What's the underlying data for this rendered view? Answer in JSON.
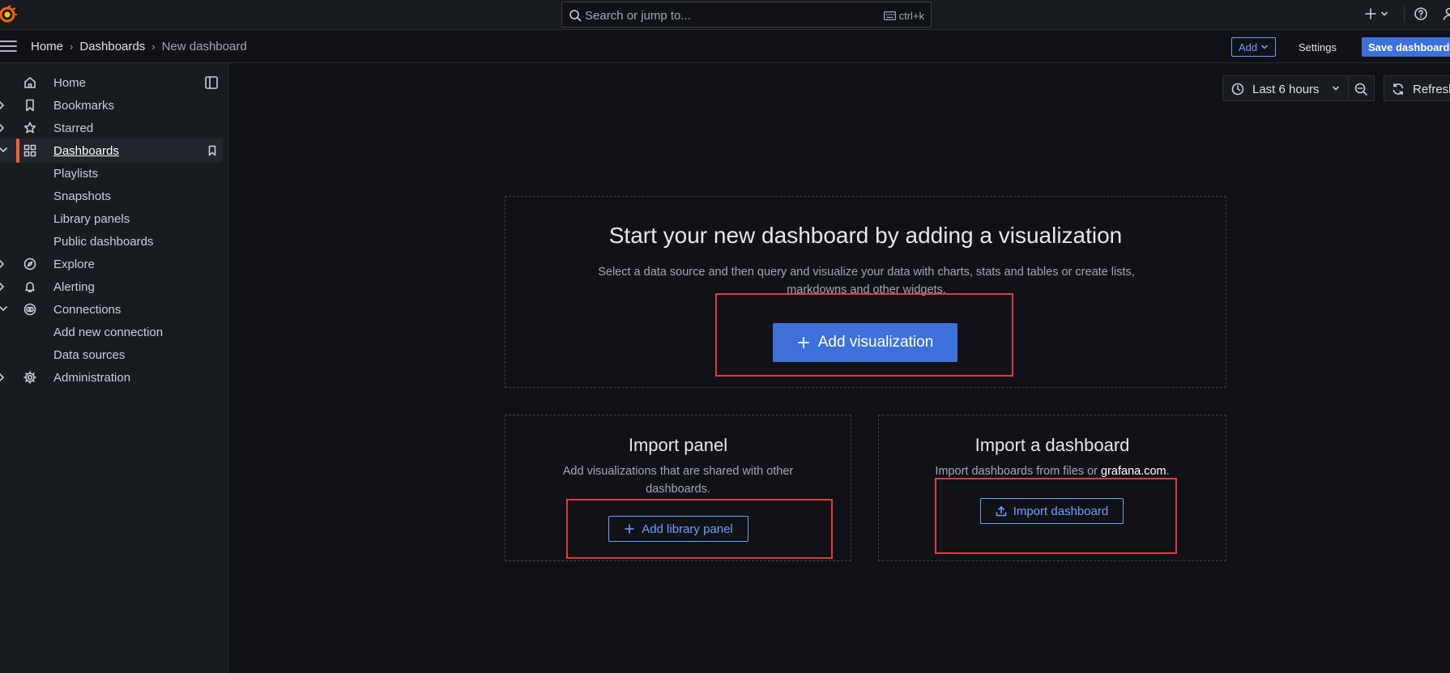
{
  "topbar": {
    "search_placeholder": "Search or jump to...",
    "search_shortcut": "ctrl+k",
    "icons": [
      "grafana-logo",
      "search-icon",
      "keyboard-icon",
      "plus-icon",
      "chevron-down-icon",
      "help-icon",
      "profile-icon"
    ]
  },
  "breadcrumb": {
    "home": "Home",
    "dashboards": "Dashboards",
    "current": "New dashboard"
  },
  "actions": {
    "add_label": "Add",
    "settings_label": "Settings",
    "save_label": "Save dashboard"
  },
  "sidebar": {
    "items": [
      {
        "label": "Home",
        "icon": "home-icon"
      },
      {
        "label": "Bookmarks",
        "icon": "bookmark-icon"
      },
      {
        "label": "Starred",
        "icon": "star-icon"
      },
      {
        "label": "Dashboards",
        "icon": "apps-icon"
      },
      {
        "label": "Playlists"
      },
      {
        "label": "Snapshots"
      },
      {
        "label": "Library panels"
      },
      {
        "label": "Public dashboards"
      },
      {
        "label": "Explore",
        "icon": "compass-icon"
      },
      {
        "label": "Alerting",
        "icon": "bell-icon"
      },
      {
        "label": "Connections",
        "icon": "link-icon"
      },
      {
        "label": "Add new connection"
      },
      {
        "label": "Data sources"
      },
      {
        "label": "Administration",
        "icon": "cog-icon"
      }
    ]
  },
  "toolbar": {
    "time_range": "Last 6 hours",
    "refresh_label": "Refresh"
  },
  "main": {
    "title": "Start your new dashboard by adding a visualization",
    "description": "Select a data source and then query and visualize your data with charts, stats and tables or create lists, markdowns and other widgets.",
    "add_visualization": "Add visualization"
  },
  "import_panel": {
    "title": "Import panel",
    "description": "Add visualizations that are shared with other dashboards.",
    "button": "Add library panel"
  },
  "import_dashboard": {
    "title": "Import a dashboard",
    "description_prefix": "Import dashboards from files or",
    "link": "grafana.com",
    "description_suffix": ".",
    "button": "Import dashboard"
  },
  "colors": {
    "accent": "#3d71d9",
    "link_blue": "#6e9fff",
    "active_marker": "#f55f3e",
    "highlight_red": "#e5393b",
    "background": "#111217",
    "sidebar_bg": "#181b1f"
  }
}
